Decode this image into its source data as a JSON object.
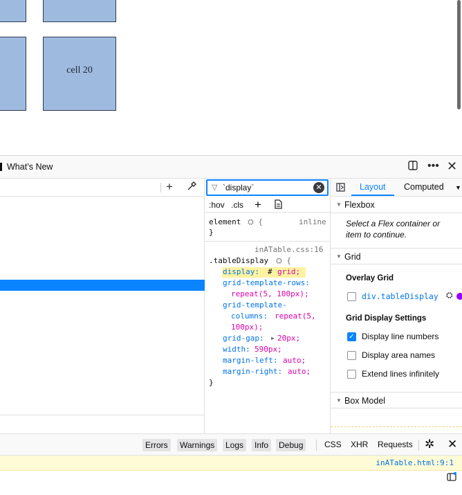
{
  "page": {
    "cell_label": "cell 20"
  },
  "devtools": {
    "toolbar": {
      "whats_new_label": "What’s New",
      "dock_icon": "dock-side-icon",
      "more_icon": "more-icon",
      "close_icon": "close-icon"
    },
    "markup": {
      "add_icon": "+",
      "picker_icon": "eyedropper-icon"
    },
    "rules": {
      "filter_value": "`display`",
      "hov_label": ":hov",
      "cls_label": ".cls",
      "add_label": "+",
      "element_selector": "element",
      "element_inline": "inline",
      "rule_source": "inATable.css:16",
      "rule_selector": ".tableDisplay",
      "decls": {
        "display_prop": "display:",
        "display_val": "grid;",
        "rows_prop": "grid-template-rows:",
        "rows_val": "repeat(5, 100px);",
        "cols_prop1": "grid-template-",
        "cols_prop2": "columns:",
        "cols_val1": "repeat(5,",
        "cols_val2": "100px);",
        "gap_prop": "grid-gap:",
        "gap_val": "20px;",
        "width_prop": "width:",
        "width_val": "590px;",
        "ml_prop": "margin-left:",
        "ml_val": "auto;",
        "mr_prop": "margin-right:",
        "mr_val": "auto;"
      }
    },
    "layout": {
      "tab_layout": "Layout",
      "tab_computed": "Computed",
      "flexbox_title": "Flexbox",
      "flexbox_note": "Select a Flex container or item to continue.",
      "grid_title": "Grid",
      "overlay_title": "Overlay Grid",
      "overlay_item": "div.tableDisplay",
      "overlay_color": "#9400ff",
      "settings_title": "Grid Display Settings",
      "settings": [
        {
          "label": "Display line numbers",
          "checked": true
        },
        {
          "label": "Display area names",
          "checked": false
        },
        {
          "label": "Extend lines infinitely",
          "checked": false
        }
      ],
      "box_model_title": "Box Model"
    },
    "console": {
      "filters": [
        "Errors",
        "Warnings",
        "Logs",
        "Info",
        "Debug"
      ],
      "css_label": "CSS",
      "xhr_label": "XHR",
      "requests_label": "Requests",
      "source_link": "inATable.html:9:1"
    },
    "accent_color": "#0a84ff"
  }
}
